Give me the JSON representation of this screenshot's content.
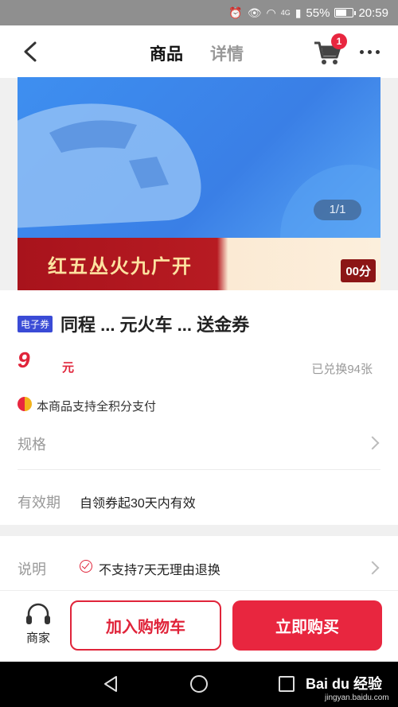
{
  "status_bar": {
    "battery": "55%",
    "time": "20:59",
    "network": "4G"
  },
  "header": {
    "tabs": [
      {
        "label": "商品",
        "active": true
      },
      {
        "label": "详情",
        "active": false
      }
    ],
    "cart_count": "1"
  },
  "banner": {
    "bottom_text": "红五丛火九广开",
    "badge_text": "00分",
    "page_indicator": "1/1"
  },
  "product": {
    "tag": "电子券",
    "title": "同程 ... 元火车 ... 送金券",
    "price": "9",
    "price_unit": "元",
    "exchanged": "已兑换94张",
    "points_note": "本商品支持全积分支付",
    "spec_label": "规格",
    "validity_label": "有效期",
    "validity_value": "自领券起30天内有效"
  },
  "description": {
    "label": "说明",
    "text": "不支持7天无理由退换"
  },
  "actions": {
    "merchant_label": "商家",
    "add_to_cart": "加入购物车",
    "buy_now": "立即购买"
  },
  "watermark": {
    "brand": "Bai du 经验",
    "url": "jingyan.baidu.com"
  },
  "colors": {
    "accent": "#e8263f",
    "banner_blue": "#3e8ff0",
    "tag_blue": "#3a4bd6"
  }
}
